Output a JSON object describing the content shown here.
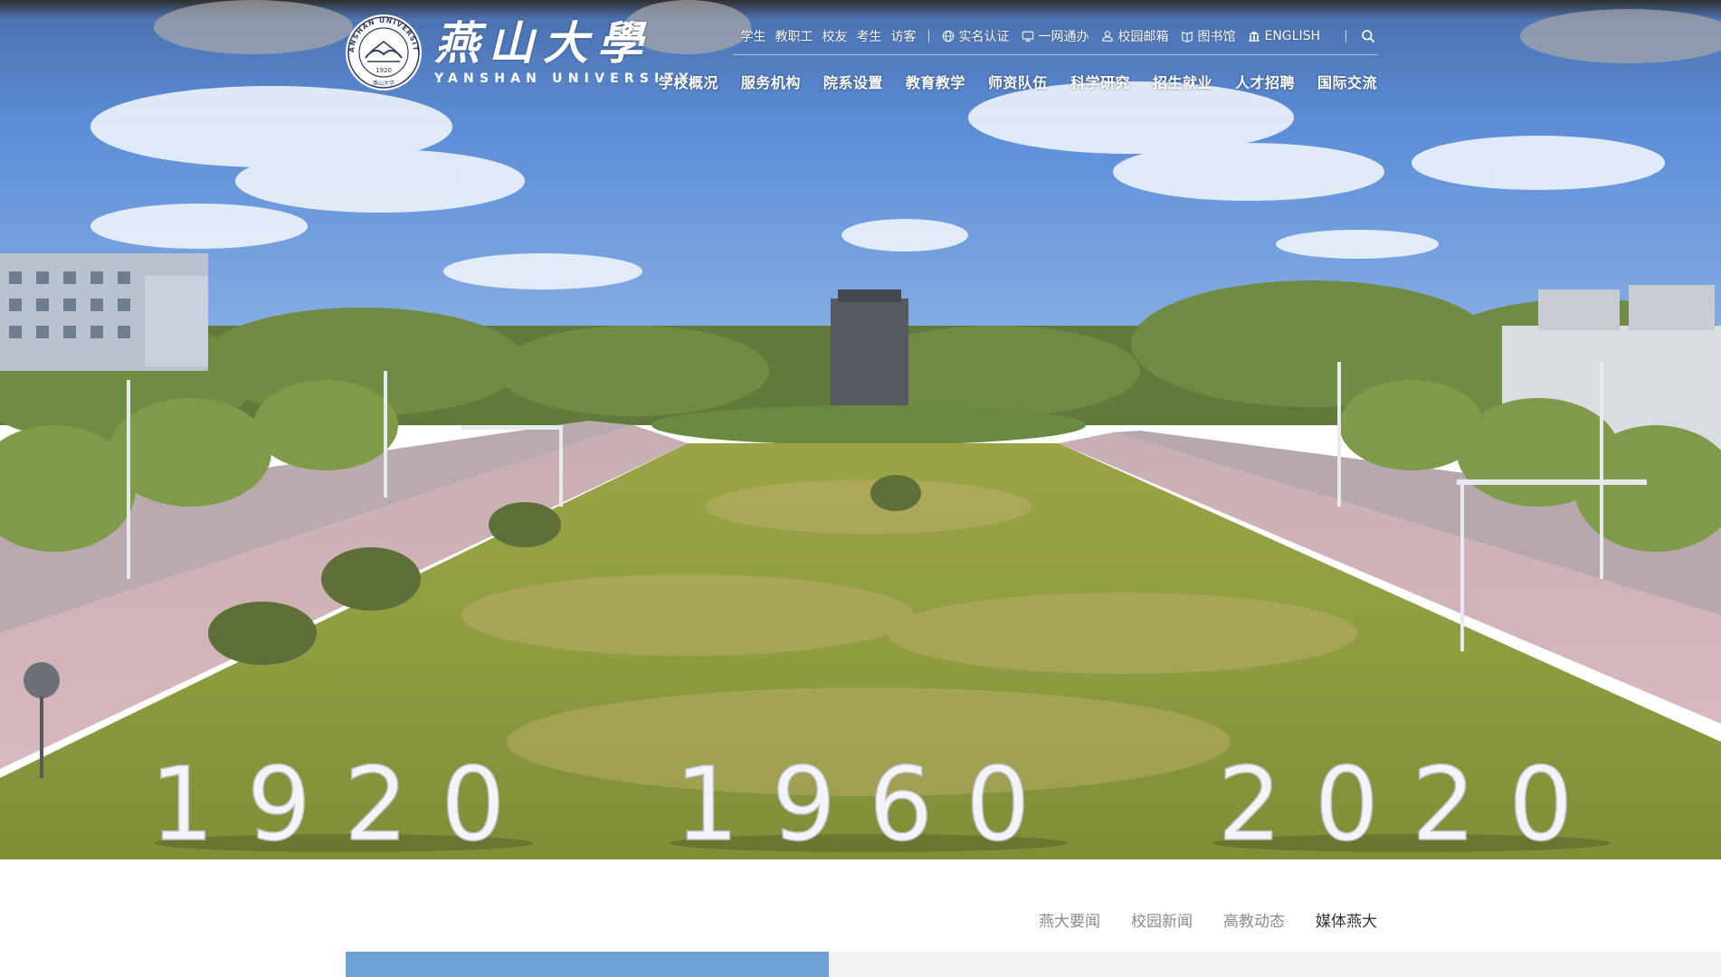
{
  "header": {
    "logo": {
      "name_cn": "燕山大學",
      "name_en": "YANSHAN UNIVERSITY",
      "seal_text": "YANSHAN UNIVERSITY",
      "seal_year": "1920",
      "seal_caption": "燕山大学"
    },
    "quick_links": [
      "学生",
      "教职工",
      "校友",
      "考生",
      "访客"
    ],
    "services": [
      {
        "label": "实名认证",
        "icon": "globe-icon"
      },
      {
        "label": "一网通办",
        "icon": "monitor-icon"
      },
      {
        "label": "校园邮箱",
        "icon": "mail-icon"
      },
      {
        "label": "图书馆",
        "icon": "book-icon"
      },
      {
        "label": "ENGLISH",
        "icon": "building-icon"
      }
    ],
    "search_icon": "search-icon",
    "nav": [
      "学校概况",
      "服务机构",
      "院系设置",
      "教育教学",
      "师资队伍",
      "科学研究",
      "招生就业",
      "人才招聘",
      "国际交流"
    ]
  },
  "hero": {
    "years": [
      "1920",
      "1960",
      "2020"
    ]
  },
  "news": {
    "tabs": [
      "燕大要闻",
      "校园新闻",
      "高教动态",
      "媒体燕大"
    ],
    "active_tab": 3
  },
  "colors": {
    "accent_blue": "#6ea0d8",
    "sky": "#5f8fd6",
    "grass": "#8aa04a"
  }
}
